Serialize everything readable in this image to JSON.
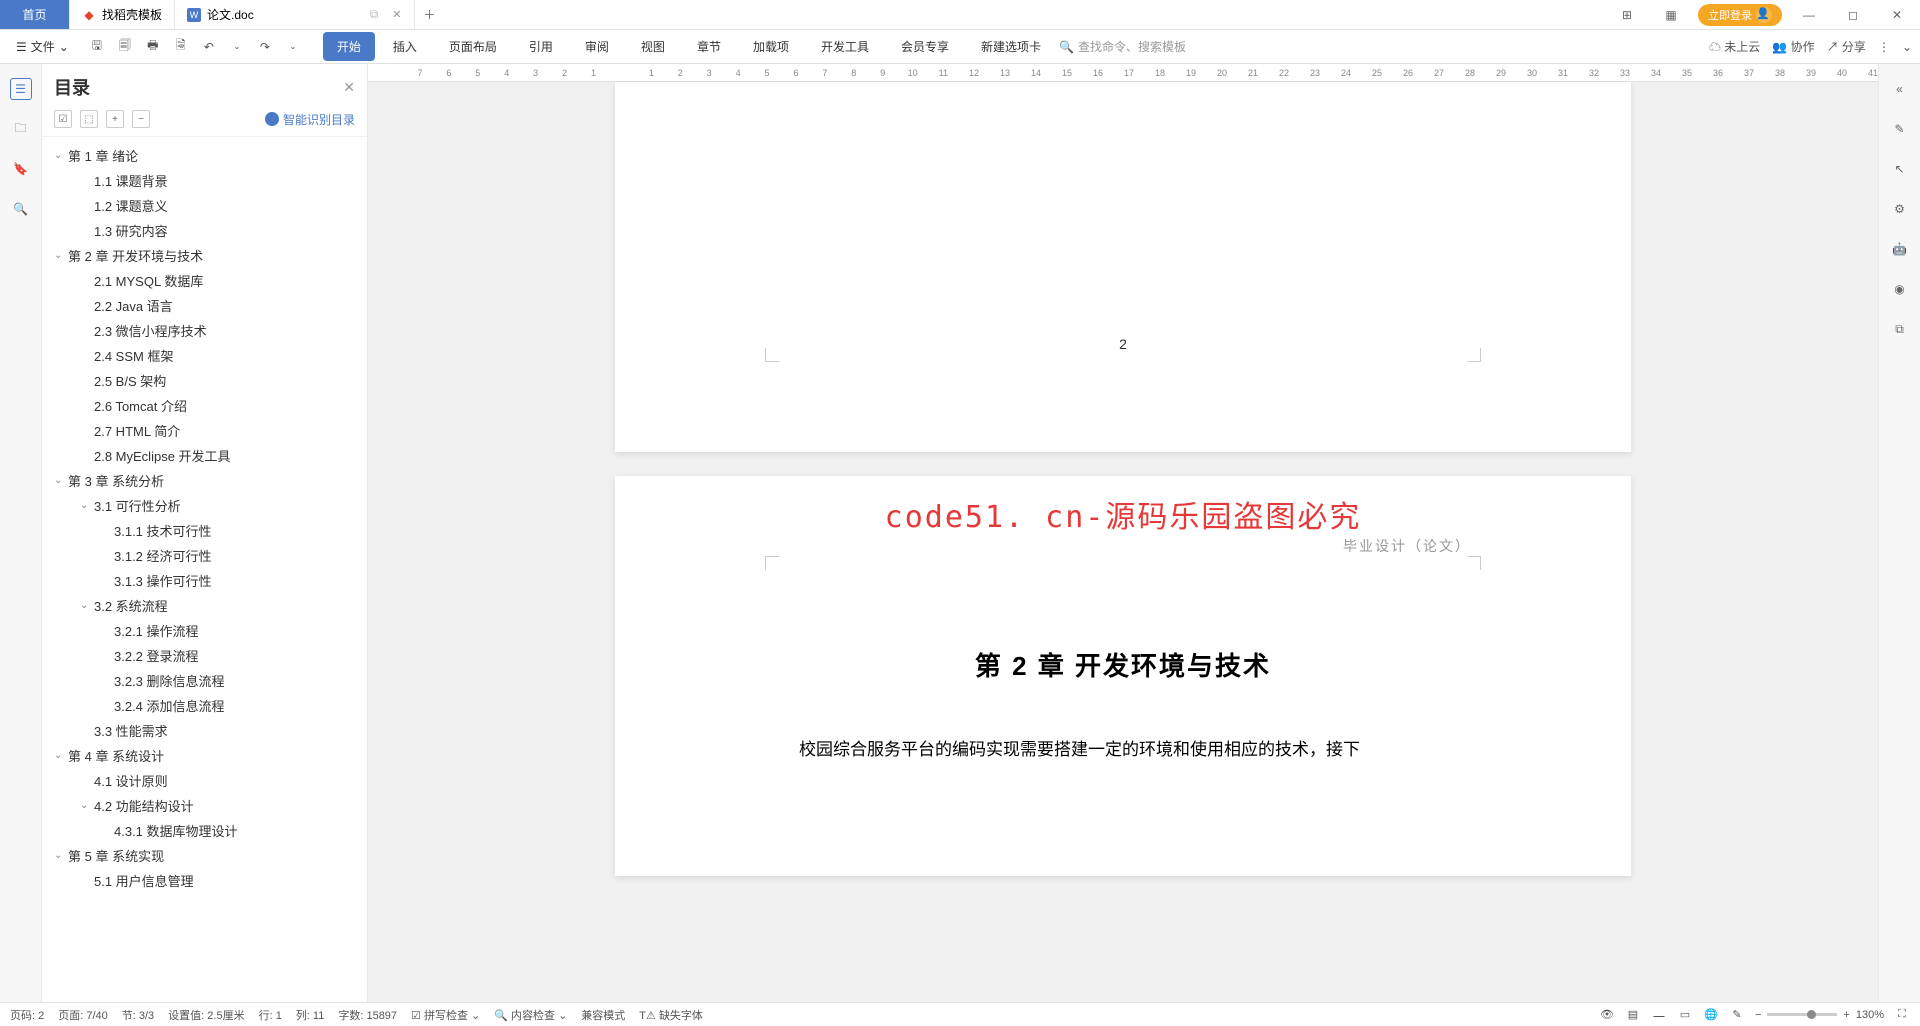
{
  "tabs": {
    "home": "首页",
    "t1": "找稻壳模板",
    "t2": "论文.doc"
  },
  "titlebar": {
    "login": "立即登录"
  },
  "ribbon": {
    "file": "文件",
    "tabs": [
      "开始",
      "插入",
      "页面布局",
      "引用",
      "审阅",
      "视图",
      "章节",
      "加载项",
      "开发工具",
      "会员专享",
      "新建选项卡"
    ],
    "search_ph": "查找命令、搜索模板",
    "cloud": "未上云",
    "collab": "协作",
    "share": "分享"
  },
  "toc": {
    "title": "目录",
    "smart": "智能识别目录",
    "items": [
      {
        "lv": 1,
        "exp": true,
        "label": "第 1 章  绪论"
      },
      {
        "lv": 2,
        "label": "1.1  课题背景"
      },
      {
        "lv": 2,
        "label": "1.2  课题意义"
      },
      {
        "lv": 2,
        "label": "1.3  研究内容"
      },
      {
        "lv": 1,
        "exp": true,
        "label": "第 2 章  开发环境与技术"
      },
      {
        "lv": 2,
        "label": "2.1  MYSQL 数据库"
      },
      {
        "lv": 2,
        "label": "2.2  Java 语言"
      },
      {
        "lv": 2,
        "label": "2.3  微信小程序技术"
      },
      {
        "lv": 2,
        "label": "2.4  SSM 框架"
      },
      {
        "lv": 2,
        "label": "2.5  B/S 架构"
      },
      {
        "lv": 2,
        "label": "2.6  Tomcat  介绍"
      },
      {
        "lv": 2,
        "label": "2.7  HTML 简介"
      },
      {
        "lv": 2,
        "label": "2.8  MyEclipse 开发工具"
      },
      {
        "lv": 1,
        "exp": true,
        "label": "第 3 章  系统分析"
      },
      {
        "lv": 2,
        "exp": true,
        "label": "3.1  可行性分析"
      },
      {
        "lv": 3,
        "label": "3.1.1  技术可行性"
      },
      {
        "lv": 3,
        "label": "3.1.2  经济可行性"
      },
      {
        "lv": 3,
        "label": "3.1.3  操作可行性"
      },
      {
        "lv": 2,
        "exp": true,
        "label": "3.2  系统流程"
      },
      {
        "lv": 3,
        "label": "3.2.1  操作流程"
      },
      {
        "lv": 3,
        "label": "3.2.2  登录流程"
      },
      {
        "lv": 3,
        "label": "3.2.3  删除信息流程"
      },
      {
        "lv": 3,
        "label": "3.2.4  添加信息流程"
      },
      {
        "lv": 2,
        "label": "3.3  性能需求"
      },
      {
        "lv": 1,
        "exp": true,
        "label": "第 4 章  系统设计"
      },
      {
        "lv": 2,
        "label": "4.1  设计原则"
      },
      {
        "lv": 2,
        "exp": true,
        "label": "4.2  功能结构设计"
      },
      {
        "lv": 3,
        "label": "4.3.1  数据库物理设计"
      },
      {
        "lv": 1,
        "exp": true,
        "label": "第 5 章  系统实现"
      },
      {
        "lv": 2,
        "label": "5.1  用户信息管理"
      }
    ]
  },
  "ruler": [
    "7",
    "6",
    "5",
    "4",
    "3",
    "2",
    "1",
    "",
    "1",
    "2",
    "3",
    "4",
    "5",
    "6",
    "7",
    "8",
    "9",
    "10",
    "11",
    "12",
    "13",
    "14",
    "15",
    "16",
    "17",
    "18",
    "19",
    "20",
    "21",
    "22",
    "23",
    "24",
    "25",
    "26",
    "27",
    "28",
    "29",
    "30",
    "31",
    "32",
    "33",
    "34",
    "35",
    "36",
    "37",
    "38",
    "39",
    "40",
    "41"
  ],
  "doc": {
    "page1num": "2",
    "watermark": "code51. cn-源码乐园盗图必究",
    "hdr_label": "毕业设计（论文）",
    "heading": "第 2 章  开发环境与技术",
    "body": "校园综合服务平台的编码实现需要搭建一定的环境和使用相应的技术，接下"
  },
  "status": {
    "page_code": "页码: 2",
    "page": "页面: 7/40",
    "section": "节: 3/3",
    "setval": "设置值: 2.5厘米",
    "row": "行: 1",
    "col": "列: 11",
    "chars": "字数: 15897",
    "spell": "拼写检查",
    "content": "内容检查",
    "compat": "兼容模式",
    "missing": "缺失字体",
    "zoom": "130%"
  }
}
